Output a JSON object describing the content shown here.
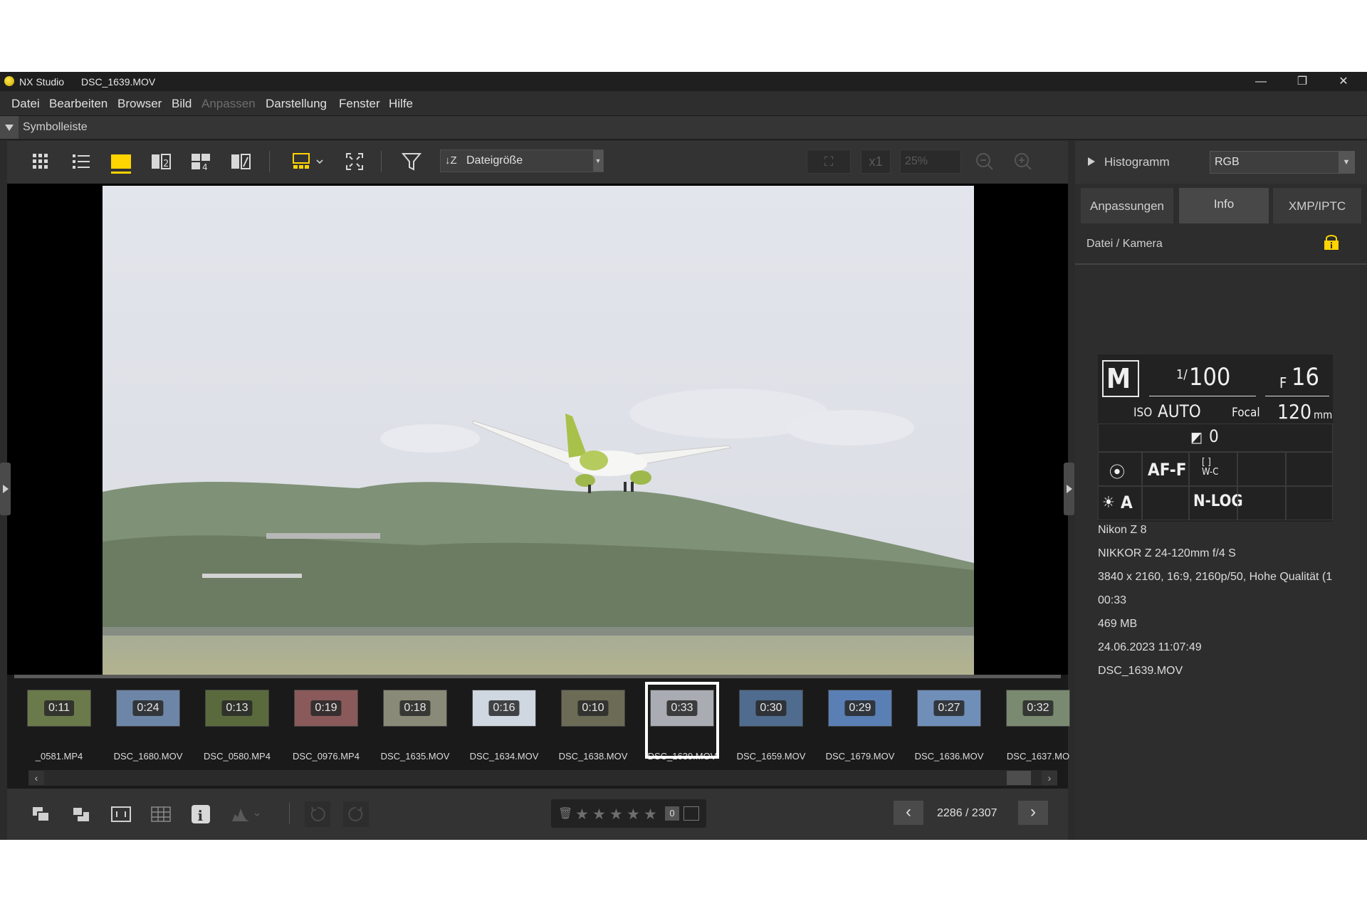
{
  "window": {
    "app_name": "NX Studio",
    "file_name": "DSC_1639.MOV",
    "minimize": "—",
    "restore": "❐",
    "close": "✕"
  },
  "menu": [
    "Datei",
    "Bearbeiten",
    "Browser",
    "Bild",
    "Anpassen",
    "Darstellung",
    "Fenster",
    "Hilfe"
  ],
  "menu_disabled": [
    "Anpassen"
  ],
  "symbolbar": {
    "label": "Symbolleiste"
  },
  "toolbar": {
    "sort_label": "Dateigröße",
    "zoom_factor": "x1",
    "zoom_level": "25%"
  },
  "filmstrip": {
    "items": [
      {
        "duration": "0:11",
        "label": "_0581.MP4",
        "bg": "#6b7a4a"
      },
      {
        "duration": "0:24",
        "label": "DSC_1680.MOV",
        "bg": "#6d86a8"
      },
      {
        "duration": "0:13",
        "label": "DSC_0580.MP4",
        "bg": "#5b6a3c"
      },
      {
        "duration": "0:19",
        "label": "DSC_0976.MP4",
        "bg": "#8a5a5a"
      },
      {
        "duration": "0:18",
        "label": "DSC_1635.MOV",
        "bg": "#8a8a78"
      },
      {
        "duration": "0:16",
        "label": "DSC_1634.MOV",
        "bg": "#cfd7e0"
      },
      {
        "duration": "0:10",
        "label": "DSC_1638.MOV",
        "bg": "#6c6c56"
      },
      {
        "duration": "0:33",
        "label": "DSC_1639.MOV",
        "bg": "#a9acb2"
      },
      {
        "duration": "0:30",
        "label": "DSC_1659.MOV",
        "bg": "#4f6c8e"
      },
      {
        "duration": "0:29",
        "label": "DSC_1679.MOV",
        "bg": "#5a7fb4"
      },
      {
        "duration": "0:27",
        "label": "DSC_1636.MOV",
        "bg": "#6f8fb8"
      },
      {
        "duration": "0:32",
        "label": "DSC_1637.MO",
        "bg": "#7a8a70"
      }
    ],
    "selected_index": 7
  },
  "bottom": {
    "rating_count": "0",
    "page_counter": "2286 / 2307",
    "stars": 5,
    "rating": 0
  },
  "right_panel": {
    "histogram_label": "Histogramm",
    "channel": "RGB",
    "tabs": [
      "Anpassungen",
      "Info",
      "XMP/IPTC"
    ],
    "active_tab": "Info",
    "section_title": "Datei / Kamera",
    "exif": {
      "mode": "M",
      "shutter_prefix": "1/",
      "shutter": "100",
      "aperture_prefix": "F",
      "aperture": "16",
      "iso_label": "ISO",
      "iso_value": "AUTO",
      "focal_label": "Focal",
      "focal_value": "120",
      "focal_unit": "mm",
      "exposure_comp": "0",
      "focus_mode": "AF-F",
      "wb_mode": "A",
      "picture_control": "N-LOG"
    },
    "info_lines": [
      "Nikon Z 8",
      "NIKKOR Z 24-120mm f/4 S",
      "3840 x 2160, 16:9, 2160p/50, Hohe Qualität (1",
      "00:33",
      "469 MB",
      "24.06.2023 11:07:49",
      "DSC_1639.MOV"
    ]
  },
  "colors": {
    "accent_yellow": "#ffd400",
    "background": "#2b2b2b"
  }
}
